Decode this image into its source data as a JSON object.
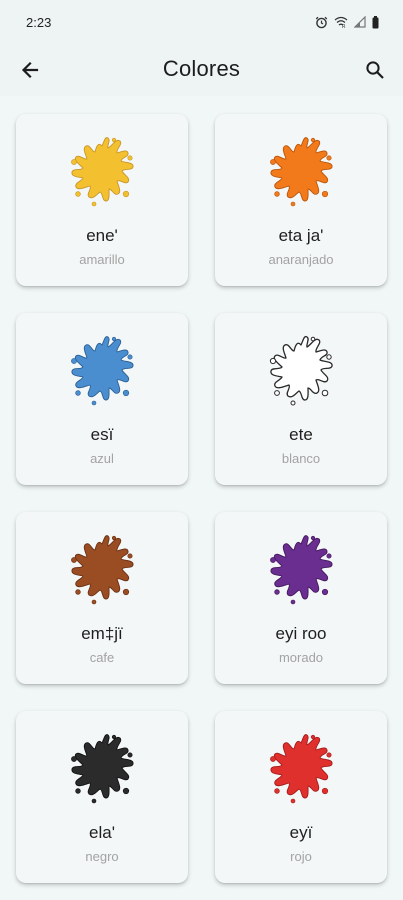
{
  "status_bar": {
    "time": "2:23",
    "icons": [
      "alarm-icon",
      "wifi-icon",
      "signal-icon",
      "battery-icon"
    ]
  },
  "app_bar": {
    "title": "Colores",
    "back_icon": "back-arrow-icon",
    "search_icon": "search-icon"
  },
  "colors": [
    {
      "word": "ene'",
      "translation": "amarillo",
      "color": "#f3c12f",
      "outline": "#c9952a"
    },
    {
      "word": "eta ja'",
      "translation": "anaranjado",
      "color": "#f27a1a",
      "outline": "#b8550c"
    },
    {
      "word": "esï",
      "translation": "azul",
      "color": "#4a8ed0",
      "outline": "#2b5f95"
    },
    {
      "word": "ete",
      "translation": "blanco",
      "color": "#ffffff",
      "outline": "#2a2a2a"
    },
    {
      "word": "em‡jï",
      "translation": "cafe",
      "color": "#9a4c22",
      "outline": "#6a3014"
    },
    {
      "word": "eyi roo",
      "translation": "morado",
      "color": "#6a2d90",
      "outline": "#43185c"
    },
    {
      "word": "ela'",
      "translation": "negro",
      "color": "#2b2b2b",
      "outline": "#111111"
    },
    {
      "word": "eyï",
      "translation": "rojo",
      "color": "#e0302e",
      "outline": "#a31b1a"
    }
  ]
}
